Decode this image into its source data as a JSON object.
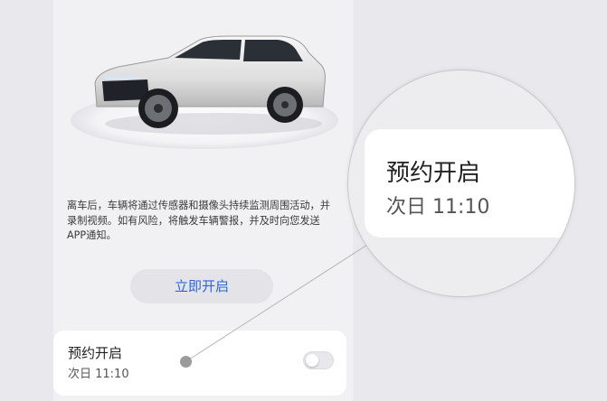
{
  "description": "离车后，车辆将通过传感器和摄像头持续监测周围活动，并录制视频。如有风险，将触发车辆警报，并及时向您发送APP通知。",
  "open_now_button": "立即开启",
  "schedule": {
    "title": "预约开启",
    "subtitle": "次日 11:10",
    "toggle_on": false
  },
  "magnifier": {
    "title": "预约开启",
    "subtitle": "次日 11:10"
  },
  "colors": {
    "accent": "#2a67d8",
    "background": "#e9e9ed",
    "card": "#ffffff"
  },
  "icons": {
    "car": "car-illustration",
    "toggle": "toggle-switch-off"
  }
}
